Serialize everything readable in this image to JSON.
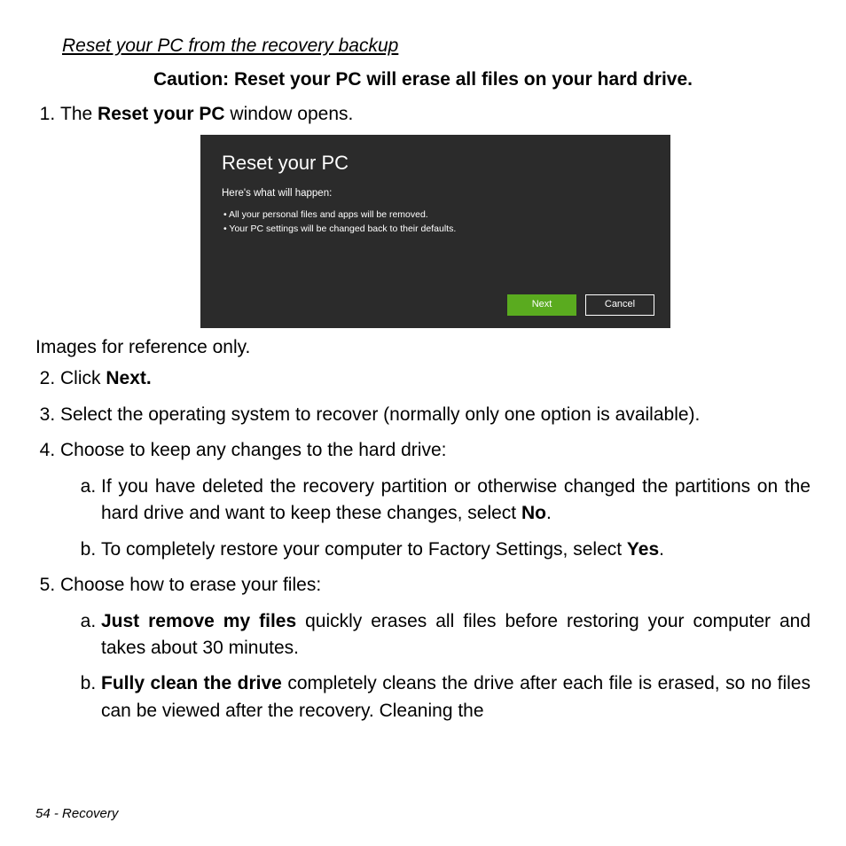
{
  "header": {
    "title": "Reset your PC from the recovery backup",
    "caution": "Caution: Reset your PC will erase all files on your hard drive."
  },
  "dialog": {
    "title": "Reset your PC",
    "subtitle": "Here's what will happen:",
    "bullet1": "All your personal files and apps will be removed.",
    "bullet2": "Your PC settings will be changed back to their defaults.",
    "next": "Next",
    "cancel": "Cancel"
  },
  "caption": "Images for reference only.",
  "steps": {
    "s1a": "The ",
    "s1b": "Reset your PC",
    "s1c": " window opens.",
    "s2a": "Click ",
    "s2b": "Next.",
    "s3": "Select the operating system to recover (normally only one option is available).",
    "s4": "Choose to keep any changes to the hard drive:",
    "s4a_a": "If you have deleted the recovery partition or otherwise changed the partitions on the hard drive and want to keep these changes, select ",
    "s4a_b": "No",
    "s4a_c": ".",
    "s4b_a": "To completely restore your computer to Factory Settings, select ",
    "s4b_b": "Yes",
    "s4b_c": ".",
    "s5": "Choose how to erase your files:",
    "s5a_a": "Just remove my files",
    "s5a_b": " quickly erases all files before restoring your computer and takes about 30 minutes.",
    "s5b_a": "Fully clean the drive",
    "s5b_b": " completely cleans the drive after each file is erased, so no files can be viewed after the recovery. Cleaning the"
  },
  "footer": "54 - Recovery"
}
